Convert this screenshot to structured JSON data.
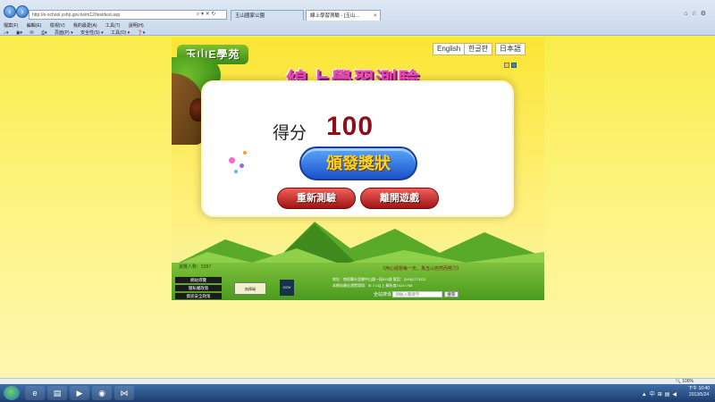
{
  "browser": {
    "address": "http://e-school.yshp.gov.tw/m12/test/test.asp",
    "tabs": [
      {
        "label": "玉山國家公園",
        "active": false
      },
      {
        "label": "線上學習測驗 - [玉山…",
        "active": true
      }
    ],
    "menu": [
      "檔案(F)",
      "編輯(E)",
      "檢視(V)",
      "我的最愛(A)",
      "工具(T)",
      "說明(H)"
    ],
    "favorites": [
      "頁面(P) ▾",
      "安全性(S) ▾",
      "工具(O) ▾"
    ],
    "zoom": "100%"
  },
  "game": {
    "logo_text": "玉山E學苑",
    "languages": [
      "English",
      "한글판",
      "日本語"
    ],
    "title": "線上學習測驗",
    "score_label": "得分",
    "score_value": "100",
    "award_button": "頒發獎狀",
    "retest_button": "重新測驗",
    "leave_button": "離開遊戲",
    "visitor_label": "瀏覽人數：5397",
    "footer_links": [
      "網站導覽",
      "隱私權政策",
      "資訊安全政策"
    ],
    "search_label": "全站搜尋",
    "search_placeholder": "請輸入關鍵字",
    "search_button": "搜尋",
    "slogan": "《用心經營每一天，為玉山自然而努力》",
    "footer_line1": "地址：南投縣水里鄉中山路一段515號 電話：(049)2773121",
    "footer_line2": "本網站最佳瀏覽環境：IE 7.0以上 解析度1024×768"
  },
  "taskbar": {
    "time": "下午 10:40",
    "date": "2013/5/24"
  }
}
